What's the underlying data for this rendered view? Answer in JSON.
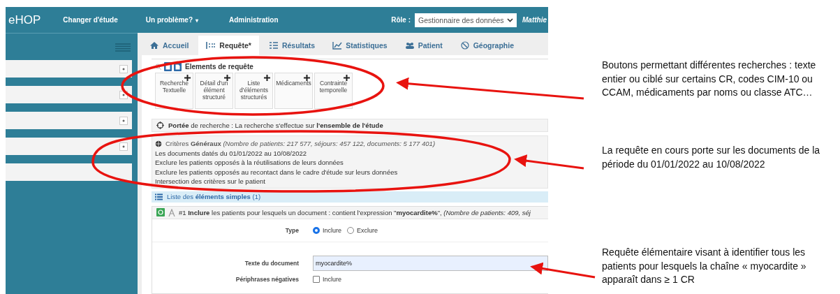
{
  "navbar": {
    "logo": "eHOP",
    "links": [
      {
        "label": "Changer d'étude",
        "kind": "link"
      },
      {
        "label": "Un problème?",
        "kind": "dropdown",
        "caret": "▾"
      },
      {
        "label": "Administration",
        "kind": "link"
      }
    ],
    "role_label": "Rôle :",
    "role_select": "Gestionnaire des données",
    "user": "Matthie"
  },
  "sidebar": {
    "panels": [
      {
        "kind": "button"
      },
      {
        "kind": "button"
      },
      {
        "kind": "button"
      },
      {
        "kind": "button"
      },
      {
        "kind": "plain"
      }
    ]
  },
  "tabs": [
    {
      "label": "Accueil",
      "selected": false
    },
    {
      "label": "Requête*",
      "selected": true
    },
    {
      "label": "Résultats",
      "selected": false
    },
    {
      "label": "Statistiques",
      "selected": false
    },
    {
      "label": "Patient",
      "selected": false
    },
    {
      "label": "Géographie",
      "selected": false
    }
  ],
  "elements_panel": {
    "title": "Elements de requête",
    "tiles": [
      {
        "label": "Recherche Textuelle"
      },
      {
        "label": "Détail d'un élément structuré"
      },
      {
        "label": "Liste d'éléments structurés"
      },
      {
        "label": "Médicaments"
      },
      {
        "label": "Contrainte temporelle"
      }
    ]
  },
  "scope": "**Portée** de recherche : La recherche s'effectue sur **l'ensemble de l'étude**",
  "criteria": {
    "header": "Critères **Généraux** *(Nombre de patients: 217 577, séjours: 457 122, documents: 5 177 401)*",
    "lines": [
      "Les documents datés du 01/01/2022 au 10/08/2022",
      "Exclure les patients opposés à la réutilisations de leurs données",
      "Exclure les patients opposés au recontact dans le cadre d'étude sur leurs données",
      "Intersection des critères sur le patient"
    ]
  },
  "simple_list": {
    "header": "Liste des **éléments simples** (1)",
    "item": "#1 **Inclure** les patients pour lesquels un document : contient l'expression \"**myocardite%**\", *(Nombre de patients: 409, séj*"
  },
  "form": {
    "type_label": "Type",
    "radios": [
      {
        "label": "Inclure",
        "selected": true
      },
      {
        "label": "Exclure",
        "selected": false
      }
    ],
    "text_label": "Texte du document",
    "text_value": "myocardite%",
    "periphrase_label": "Périphrases négatives",
    "checkbox": {
      "label": "Inclure",
      "checked": false
    }
  },
  "annotations": [
    {
      "text": "Boutons permettant différentes recherches : texte entier ou ciblé sur certains CR, codes CIM-10 ou CCAM, médicaments par noms ou classe ATC…"
    },
    {
      "text": "La requête en cours porte sur les documents de la période du 01/01/2022 au 10/08/2022"
    },
    {
      "text": "Requête élémentaire visant à identifier tous les patients pour lesquels la chaîne « myocardite » apparaît dans ≥ 1 CR"
    }
  ]
}
